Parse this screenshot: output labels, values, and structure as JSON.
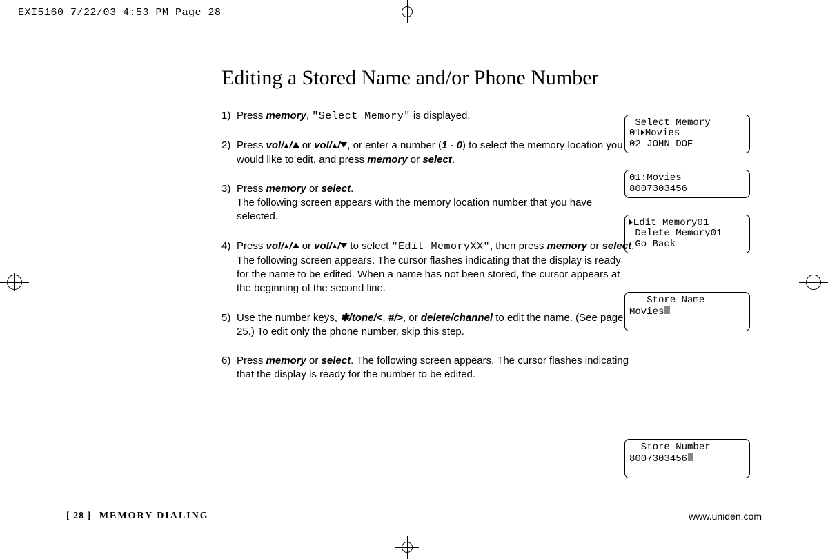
{
  "print_header": "EXI5160  7/22/03 4:53 PM  Page 28",
  "title": "Editing a Stored Name and/or Phone Number",
  "steps": {
    "s1_a": "Press ",
    "s1_mem": "memory",
    "s1_b": ", ",
    "s1_lcd": "\"Select Memory\"",
    "s1_c": " is displayed.",
    "s2_a": "Press ",
    "s2_vol1": "vol/",
    "s2_or": " or ",
    "s2_vol2": "vol/",
    "s2_b": ", or enter a number (",
    "s2_range": "1 - 0",
    "s2_c": ") to select the memory location you would like to edit, and press ",
    "s2_mem": "memory",
    "s2_or2": " or ",
    "s2_sel": "select",
    "s2_d": ".",
    "s3_a": "Press ",
    "s3_mem": "memory",
    "s3_or": " or ",
    "s3_sel": "select",
    "s3_b": ".",
    "s3_c": "The following screen appears with the memory location number that you have selected.",
    "s4_a": "Press ",
    "s4_vol1": "vol/",
    "s4_or": " or ",
    "s4_vol2": "vol/",
    "s4_b": " to select ",
    "s4_lcd": "\"Edit MemoryXX\"",
    "s4_c": ", then press ",
    "s4_mem": "memory",
    "s4_or2": " or ",
    "s4_sel": "select",
    "s4_d": ". The following screen appears. The cursor flashes indicating that the display is ready for the name to be edited. When a name has not been stored, the cursor appears at the beginning of the second line.",
    "s5_a": "Use the number keys, ",
    "s5_tone": "/tone/",
    "s5_comma": ", ",
    "s5_hash": "#/",
    "s5_comma2": ", or ",
    "s5_del": "delete/channel",
    "s5_b": " to edit the name. (See page 25.) To edit only the phone number, skip this step.",
    "s6_a": "Press ",
    "s6_mem": "memory",
    "s6_or": " or ",
    "s6_sel": "select",
    "s6_b": ". The following screen appears. The cursor flashes indicating that the display is ready for the number to be edited."
  },
  "lcds": {
    "l1_1": " Select Memory",
    "l1_2a": "01",
    "l1_2b": "Movies",
    "l1_3": "02 JOHN DOE",
    "l2_1": "01:Movies",
    "l2_2": "8007303456",
    "l3_1": "Edit Memory01",
    "l3_2": " Delete Memory01",
    "l3_3": " Go Back",
    "l4_1": "   Store Name",
    "l4_2": "Movies",
    "l5_1": "  Store Number",
    "l5_2": "8007303456"
  },
  "footer": {
    "page": "[ 28 ]",
    "section": "MEMORY DIALING",
    "url": "www.uniden.com"
  }
}
